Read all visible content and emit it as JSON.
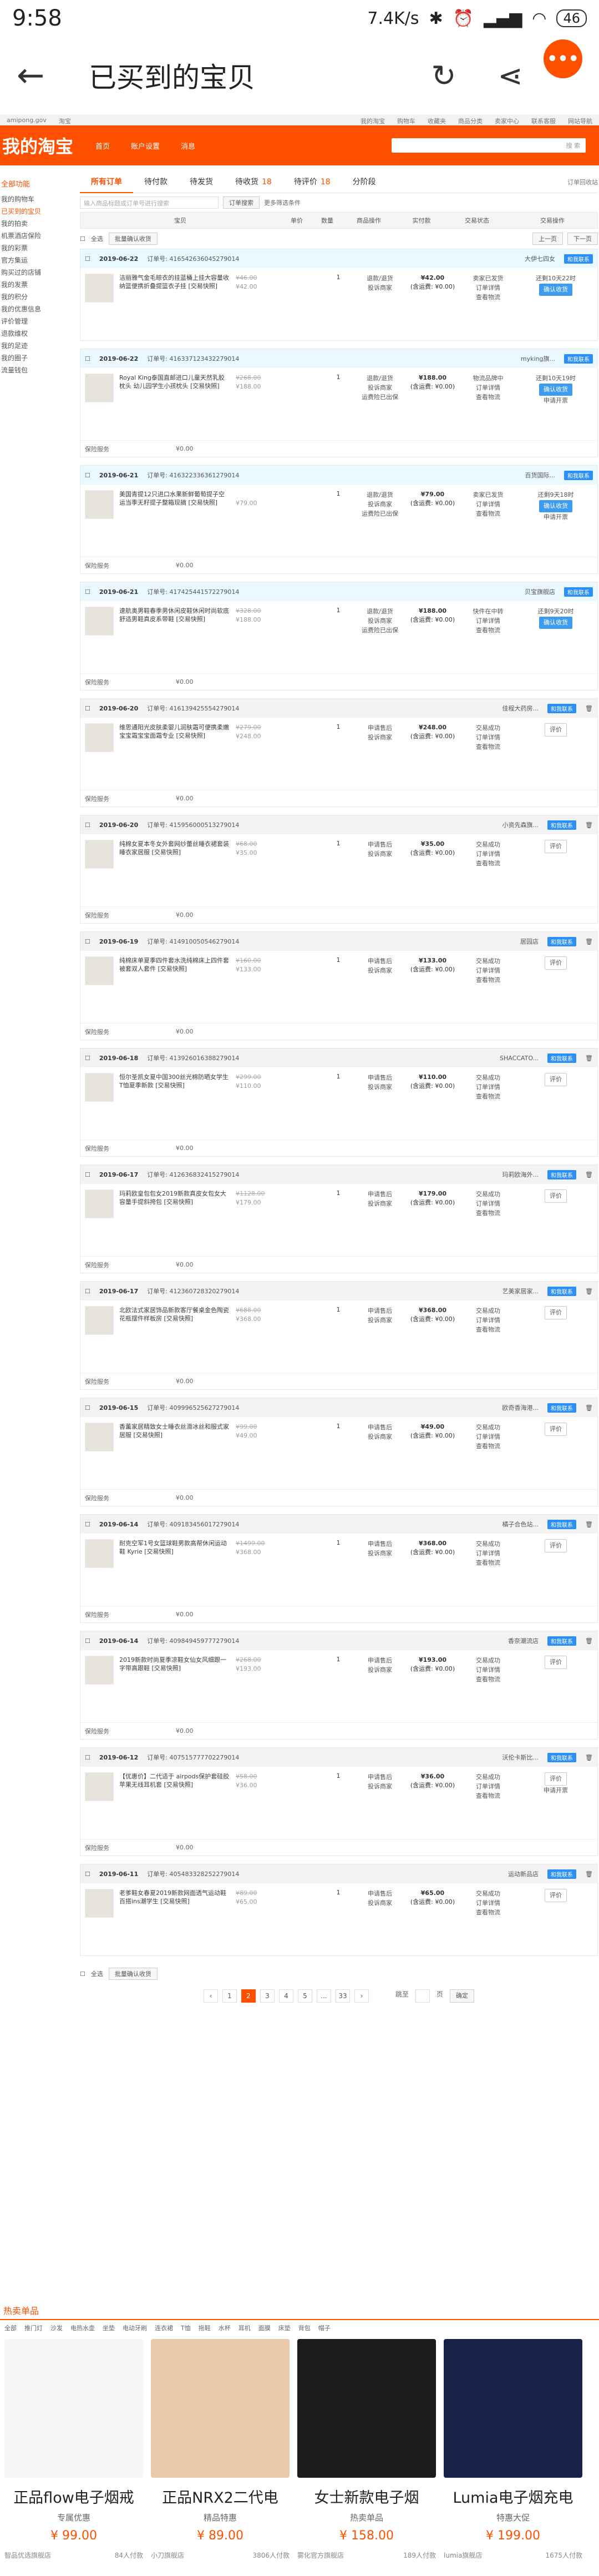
{
  "statusbar": {
    "time": "9:58",
    "right": "7.4K/s",
    "battery": "46"
  },
  "appbar": {
    "title": "已买到的宝贝",
    "menu": "•••"
  },
  "site": {
    "topline": [
      "amipong.gov",
      "淘宝",
      "我的淘宝",
      "购物车",
      "收藏夹",
      "商品分类",
      "卖家中心",
      "联系客服",
      "网站导航"
    ],
    "logo": "我的淘宝",
    "nav": [
      "首页",
      "账户设置",
      "消息"
    ],
    "search_btn": "搜 索"
  },
  "leftnav": {
    "head": "全部功能",
    "items": [
      "我的购物车",
      "已买到的宝贝",
      "我的拍卖",
      "机票酒店保险",
      "我的彩票",
      "官方集运",
      "购买过的店铺",
      "我的发票",
      "我的积分",
      "我的优惠信息",
      "评价管理",
      "退款维权",
      "我的足迹",
      "我的圈子",
      "流量钱包"
    ]
  },
  "tabs": [
    {
      "label": "所有订单",
      "num": ""
    },
    {
      "label": "待付款",
      "num": ""
    },
    {
      "label": "待发货",
      "num": ""
    },
    {
      "label": "待收货",
      "num": "18"
    },
    {
      "label": "待评价",
      "num": "18"
    },
    {
      "label": "分阶段",
      "num": ""
    }
  ],
  "recycle": "订单回收站",
  "search": {
    "placeholder": "输入商品标题或订单号进行搜索",
    "button": "订单搜索",
    "more": "更多筛选条件"
  },
  "thead": [
    "宝贝",
    "单价",
    "数量",
    "商品操作",
    "实付款",
    "交易状态",
    "交易操作"
  ],
  "batch": {
    "select_all": "全选",
    "confirm": "批量确认收货",
    "prev": "上一页",
    "next": "下一页"
  },
  "orders": [
    {
      "date": "2019-06-22",
      "no": "订单号: 416542636045279014",
      "shop": "大伊七四女",
      "title": "洁丽雅气金毛晾衣的挂蓝桶上挂大容量收纳篮便携折叠提篮衣子挂 [交易快照]",
      "price_old": "¥46.00",
      "price": "¥42.00",
      "qty": "1",
      "ops": [
        "退款/退货",
        "投诉商家"
      ],
      "pay": "¥42.00",
      "pay_note": "(含运费: ¥0.00)",
      "status": [
        "卖家已发货",
        "订单详情",
        "查看物流"
      ],
      "act": [
        "还剩10天22时",
        "确认收货"
      ],
      "foot": "",
      "done": false
    },
    {
      "date": "2019-06-22",
      "no": "订单号: 416337123432279014",
      "shop": "myking旗...",
      "title": "Royal King泰国直邮进口儿童天然乳胶枕头 幼儿园学生小孩枕头 [交易快照]",
      "price_old": "¥268.00",
      "price": "¥188.00",
      "qty": "1",
      "ops": [
        "退款/退货",
        "投诉商家",
        "运费险已出保"
      ],
      "pay": "¥188.00",
      "pay_note": "(含运费: ¥0.00)",
      "status": [
        "物流品牌中",
        "订单详情",
        "查看物流"
      ],
      "act": [
        "还剩10天19时",
        "确认收货",
        "申请开票"
      ],
      "foot": "保险服务",
      "done": false
    },
    {
      "date": "2019-06-21",
      "no": "订单号: 416322336361279014",
      "shop": "百货国际...",
      "title": "美国青提12只进口水果新鲜葡萄提子空运当季无籽提子整箱现摘 [交易快照]",
      "price_old": "",
      "price": "¥79.00",
      "qty": "1",
      "ops": [
        "退款/退货",
        "投诉商家",
        "运费险已出保"
      ],
      "pay": "¥79.00",
      "pay_note": "(含运费: ¥0.00)",
      "status": [
        "卖家已发货",
        "订单详情",
        "查看物流"
      ],
      "act": [
        "还剩9天18时",
        "确认收货",
        "申请开票"
      ],
      "foot": "保险服务",
      "done": false
    },
    {
      "date": "2019-06-21",
      "no": "订单号: 417425441572279014",
      "shop": "贝宝旗舰店",
      "title": "速航奥男鞋春季男休闲皮鞋休闲时尚软底舒适男鞋真皮系带鞋 [交易快照]",
      "price_old": "¥328.00",
      "price": "¥188.00",
      "qty": "1",
      "ops": [
        "退款/退货",
        "投诉商家",
        "运费险已出保"
      ],
      "pay": "¥188.00",
      "pay_note": "(含运费: ¥0.00)",
      "status": [
        "快件在中转",
        "订单详情",
        "查看物流"
      ],
      "act": [
        "还剩9天20时",
        "确认收货"
      ],
      "foot": "保险服务",
      "done": false
    },
    {
      "date": "2019-06-20",
      "no": "订单号: 416139425554279014",
      "shop": "佳程大药房...",
      "title": "维思通阳光皮肤柔婴儿润肤霜可便携柔嫩宝宝霜宝宝面霜专业 [交易快照]",
      "price_old": "¥279.00",
      "price": "¥248.00",
      "qty": "1",
      "ops": [
        "申请售后",
        "投诉商家"
      ],
      "pay": "¥248.00",
      "pay_note": "(含运费: ¥0.00)",
      "status": [
        "交易成功",
        "订单详情",
        "查看物流"
      ],
      "act": [
        "评价"
      ],
      "foot": "保险服务",
      "done": true
    },
    {
      "date": "2019-06-20",
      "no": "订单号: 415956000513279014",
      "shop": "小资先森旗...",
      "title": "纯棉女夏本冬女外套网纱蕾丝睡衣裙套装睡衣家居服 [交易快照]",
      "price_old": "¥68.00",
      "price": "¥35.00",
      "qty": "1",
      "ops": [
        "申请售后",
        "投诉商家"
      ],
      "pay": "¥35.00",
      "pay_note": "(含运费: ¥0.00)",
      "status": [
        "交易成功",
        "订单详情",
        "查看物流"
      ],
      "act": [
        "评价"
      ],
      "foot": "保险服务",
      "done": true
    },
    {
      "date": "2019-06-19",
      "no": "订单号: 414910050546279014",
      "shop": "居园店",
      "title": "纯棉床单夏季四件套水洗纯棉床上四件套被套双人套件 [交易快照]",
      "price_old": "¥160.00",
      "price": "¥133.00",
      "qty": "1",
      "ops": [
        "申请售后",
        "投诉商家"
      ],
      "pay": "¥133.00",
      "pay_note": "(含运费: ¥0.00)",
      "status": [
        "交易成功",
        "订单详情",
        "查看物流"
      ],
      "act": [
        "评价"
      ],
      "foot": "保险服务",
      "done": true
    },
    {
      "date": "2019-06-18",
      "no": "订单号: 413926016388279014",
      "shop": "SHACCATO...",
      "title": "恒尔圣凯女夏中国300丝光棉防晒女学生T恤夏季新款 [交易快照]",
      "price_old": "¥299.00",
      "price": "¥110.00",
      "qty": "1",
      "ops": [
        "申请售后",
        "投诉商家"
      ],
      "pay": "¥110.00",
      "pay_note": "(含运费: ¥0.00)",
      "status": [
        "交易成功",
        "订单详情",
        "查看物流"
      ],
      "act": [
        "评价"
      ],
      "foot": "保险服务",
      "done": true
    },
    {
      "date": "2019-06-17",
      "no": "订单号: 412636832415279014",
      "shop": "玛莉欧海外...",
      "title": "玛莉欧皇包包女2019新款真皮女包女大容量手提斜挎包 [交易快照]",
      "price_old": "¥1128.00",
      "price": "¥179.00",
      "qty": "1",
      "ops": [
        "申请售后",
        "投诉商家"
      ],
      "pay": "¥179.00",
      "pay_note": "(含运费: ¥0.00)",
      "status": [
        "交易成功",
        "订单详情",
        "查看物流"
      ],
      "act": [
        "评价"
      ],
      "foot": "保险服务",
      "done": true
    },
    {
      "date": "2019-06-17",
      "no": "订单号: 412360728320279014",
      "shop": "艺美家居家...",
      "title": "北欧法式家居饰品新款客厅餐桌金色陶瓷花瓶摆件样板房 [交易快照]",
      "price_old": "¥688.00",
      "price": "¥368.00",
      "qty": "1",
      "ops": [
        "申请售后",
        "投诉商家"
      ],
      "pay": "¥368.00",
      "pay_note": "(含运费: ¥0.00)",
      "status": [
        "交易成功",
        "订单详情",
        "查看物流"
      ],
      "act": [
        "评价"
      ],
      "foot": "保险服务",
      "done": true
    },
    {
      "date": "2019-06-15",
      "no": "订单号: 409996525627279014",
      "shop": "欧奇香海港...",
      "title": "香薰家居精致女士睡衣丝滑冰丝和服式家居服 [交易快照]",
      "price_old": "¥99.00",
      "price": "¥49.00",
      "qty": "1",
      "ops": [
        "申请售后",
        "投诉商家"
      ],
      "pay": "¥49.00",
      "pay_note": "(含运费: ¥0.00)",
      "status": [
        "交易成功",
        "订单详情",
        "查看物流"
      ],
      "act": [
        "评价"
      ],
      "foot": "保险服务",
      "done": true
    },
    {
      "date": "2019-06-14",
      "no": "订单号: 409183456017279014",
      "shop": "橘子合色站...",
      "title": "耐克空军1号女篮球鞋男款高帮休闲运动鞋 Kyrie [交易快照]",
      "price_old": "¥1499.00",
      "price": "¥368.00",
      "qty": "1",
      "ops": [
        "申请售后",
        "投诉商家"
      ],
      "pay": "¥368.00",
      "pay_note": "(含运费: ¥0.00)",
      "status": [
        "交易成功",
        "订单详情",
        "查看物流"
      ],
      "act": [
        "评价"
      ],
      "foot": "保险服务",
      "done": true
    },
    {
      "date": "2019-06-14",
      "no": "订单号: 409849459777279014",
      "shop": "香奈潮流店",
      "title": "2019新款时尚夏季凉鞋女仙女风细跟一字带高跟鞋 [交易快照]",
      "price_old": "¥268.00",
      "price": "¥193.00",
      "qty": "1",
      "ops": [
        "申请售后",
        "投诉商家"
      ],
      "pay": "¥193.00",
      "pay_note": "(含运费: ¥0.00)",
      "status": [
        "交易成功",
        "订单详情",
        "查看物流"
      ],
      "act": [
        "评价"
      ],
      "foot": "保险服务",
      "done": true
    },
    {
      "date": "2019-06-12",
      "no": "订单号: 407515777702279014",
      "shop": "沃伦卡斯比...",
      "title": "【优惠价】二代适于 airpods保护套硅胶苹果无线耳机套 [交易快照]",
      "price_old": "¥58.00",
      "price": "¥36.00",
      "qty": "1",
      "ops": [
        "申请售后",
        "投诉商家"
      ],
      "pay": "¥36.00",
      "pay_note": "(含运费: ¥0.00)",
      "status": [
        "交易成功",
        "订单详情",
        "查看物流"
      ],
      "act": [
        "评价",
        "申请开票"
      ],
      "foot": "保险服务",
      "done": true
    },
    {
      "date": "2019-06-11",
      "no": "订单号: 405483328252279014",
      "shop": "运动新品店",
      "title": "老爹鞋女春夏2019新款网面透气运动鞋百搭ins潮学生 [交易快照]",
      "price_old": "¥89.00",
      "price": "¥65.00",
      "qty": "1",
      "ops": [
        "申请售后",
        "投诉商家"
      ],
      "pay": "¥65.00",
      "pay_note": "(含运费: ¥0.00)",
      "status": [
        "交易成功",
        "订单详情",
        "查看物流"
      ],
      "act": [
        "评价"
      ],
      "foot": "",
      "done": true
    }
  ],
  "pager": {
    "pages": [
      "‹",
      "1",
      "2",
      "3",
      "4",
      "5",
      "...",
      "33",
      "›"
    ],
    "current": "2",
    "goto": "跳至",
    "page": "页",
    "confirm": "确定"
  },
  "hot": {
    "title": "热卖单品",
    "cats": [
      "全部",
      "推门灯",
      "沙发",
      "电热水壶",
      "坐垫",
      "电动牙刷",
      "连衣裙",
      "T恤",
      "拖鞋",
      "水杯",
      "耳机",
      "面膜",
      "床垫",
      "背包",
      "帽子"
    ],
    "items": [
      {
        "name": "正品flow电子烟戒",
        "tag": "专属优惠",
        "price": "¥ 99.00",
        "shop": "智品优选旗舰店",
        "sold": "84人付款",
        "color": "#f5f5f5"
      },
      {
        "name": "正品NRX2二代电",
        "tag": "精品特惠",
        "price": "¥ 89.00",
        "shop": "小刀旗舰店",
        "sold": "3806人付款",
        "color": "#e8c9a8"
      },
      {
        "name": "女士新款电子烟",
        "tag": "热卖单品",
        "price": "¥ 158.00",
        "shop": "雾化官方旗舰店",
        "sold": "189人付款",
        "color": "#1b1b1b"
      },
      {
        "name": "Lumia电子烟充电",
        "tag": "特惠大促",
        "price": "¥ 199.00",
        "shop": "lumia旗舰店",
        "sold": "1675人付款",
        "color": "#16224a"
      }
    ]
  }
}
